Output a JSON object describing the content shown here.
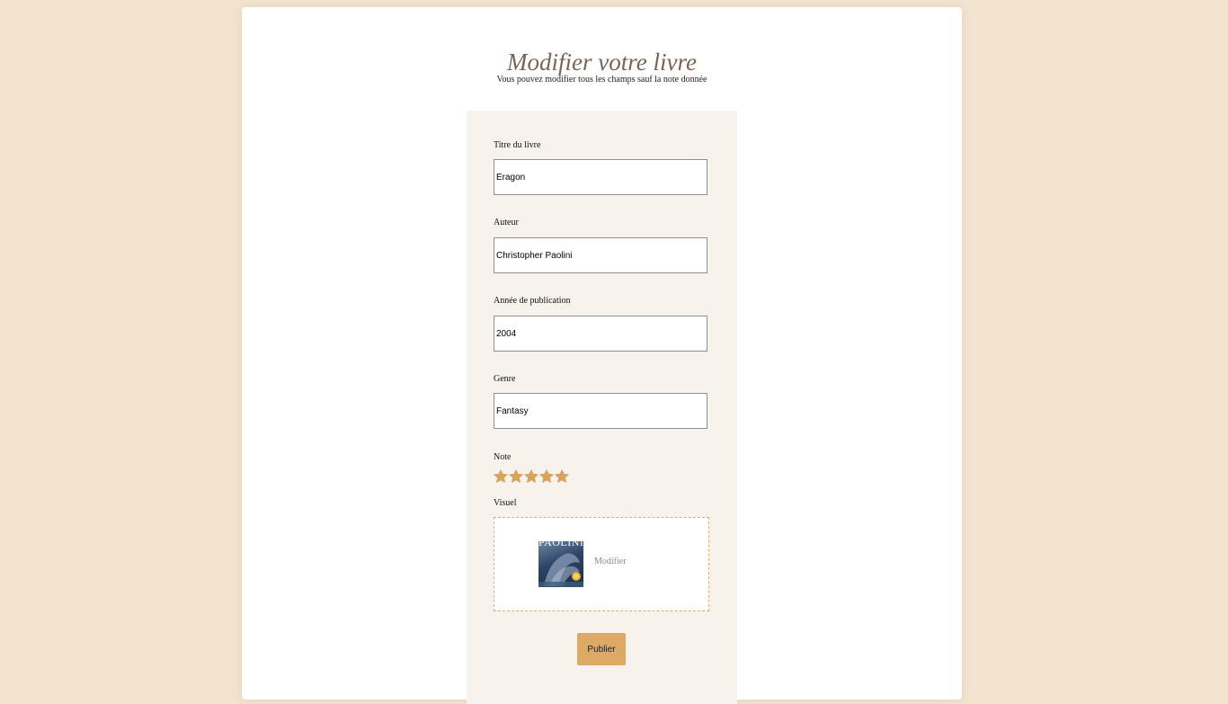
{
  "page": {
    "title": "Modifier votre livre",
    "subtitle": "Vous pouvez modifier tous les champs sauf la note donnée"
  },
  "form": {
    "title_label": "Titre du livre",
    "title_value": "Eragon",
    "author_label": "Auteur",
    "author_value": "Christopher Paolini",
    "year_label": "Année de publication",
    "year_value": "2004",
    "genre_label": "Genre",
    "genre_value": "Fantasy",
    "rating_label": "Note",
    "rating_value": 5,
    "rating_max": 5,
    "visual_label": "Visuel",
    "visual_cover_text": "PAOLINI",
    "visual_modify_label": "Modifier",
    "publish_label": "Publier"
  },
  "colors": {
    "background": "#F2E4CF",
    "title": "#7A6355",
    "panel": "#F7F2EC",
    "accent": "#DDAA66",
    "star": "#D9A35E"
  },
  "icons": {
    "rating": "star-icon"
  }
}
